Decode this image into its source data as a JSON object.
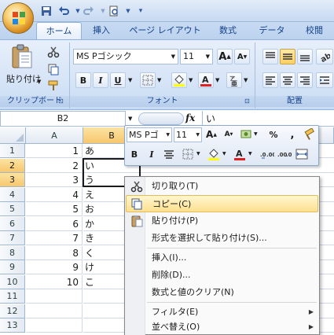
{
  "ribbon": {
    "tabs": [
      "ホーム",
      "挿入",
      "ページ レイアウト",
      "数式",
      "データ",
      "校閲"
    ],
    "paste_label": "貼り付け",
    "clipboard_label": "クリップボード",
    "font_group_label": "フォント",
    "align_group_label": "配置",
    "font_name": "MS Pゴシック",
    "font_size": "11",
    "bold": "B",
    "italic": "I",
    "underline": "U",
    "grow_font": "A",
    "shrink_font": "A"
  },
  "formula_bar": {
    "name_box": "B2",
    "fx": "fx",
    "content": "い"
  },
  "grid": {
    "columns": [
      "A",
      "B"
    ],
    "rows": [
      {
        "num": "1",
        "a": "1",
        "b": "あ"
      },
      {
        "num": "2",
        "a": "2",
        "b": "い"
      },
      {
        "num": "3",
        "a": "3",
        "b": "う"
      },
      {
        "num": "4",
        "a": "4",
        "b": "え"
      },
      {
        "num": "5",
        "a": "5",
        "b": "お"
      },
      {
        "num": "6",
        "a": "6",
        "b": "か"
      },
      {
        "num": "7",
        "a": "7",
        "b": "き"
      },
      {
        "num": "8",
        "a": "8",
        "b": "く"
      },
      {
        "num": "9",
        "a": "9",
        "b": "け"
      },
      {
        "num": "10",
        "a": "10",
        "b": "こ"
      },
      {
        "num": "11",
        "a": "",
        "b": ""
      },
      {
        "num": "12",
        "a": "",
        "b": ""
      },
      {
        "num": "13",
        "a": "",
        "b": ""
      }
    ]
  },
  "mini_toolbar": {
    "font_name": "MS Pゴ",
    "font_size": "11",
    "bold": "B",
    "italic": "I",
    "percent": "%",
    "comma": ","
  },
  "context_menu": {
    "items": [
      "切り取り(T)",
      "コピー(C)",
      "貼り付け(P)",
      "形式を選択して貼り付け(S)...",
      "挿入(I)...",
      "削除(D)...",
      "数式と値のクリア(N)",
      "フィルタ(E)",
      "並べ替え(O)"
    ]
  },
  "colors": {
    "ribbon_text": "#15428b",
    "highlight": "#ffe08e",
    "selection_header": "#f7c76c"
  }
}
